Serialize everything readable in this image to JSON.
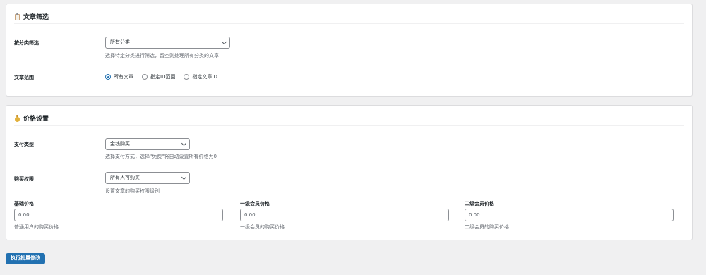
{
  "filter_section": {
    "title": "文章筛选",
    "category": {
      "label": "按分类筛选",
      "selected": "所有分类",
      "hint": "选择特定分类进行筛选，留空则处理所有分类的文章"
    },
    "range": {
      "label": "文章范围",
      "options": [
        {
          "label": "所有文章",
          "checked": true
        },
        {
          "label": "指定ID范围",
          "checked": false
        },
        {
          "label": "指定文章ID",
          "checked": false
        }
      ]
    }
  },
  "price_section": {
    "title": "价格设置",
    "payment": {
      "label": "支付类型",
      "selected": "金钱购买",
      "hint": "选择支付方式，选择\"免费\"将自动设置所有价格为0"
    },
    "permission": {
      "label": "购买权限",
      "selected": "所有人可购买",
      "hint": "设置文章的购买权限级别"
    },
    "prices": [
      {
        "label": "基础价格",
        "value": "0.00",
        "hint": "普通用户的购买价格"
      },
      {
        "label": "一级会员价格",
        "value": "0.00",
        "hint": "一级会员的购买价格"
      },
      {
        "label": "二级会员价格",
        "value": "0.00",
        "hint": "二级会员的购买价格"
      }
    ]
  },
  "submit": {
    "label": "执行批量修改"
  },
  "colors": {
    "primary": "#2271b1",
    "background": "#f0f0f1",
    "border": "#dcdcde"
  },
  "icons": {
    "filter_title": "clipboard-icon",
    "price_title": "money-bag-icon"
  }
}
